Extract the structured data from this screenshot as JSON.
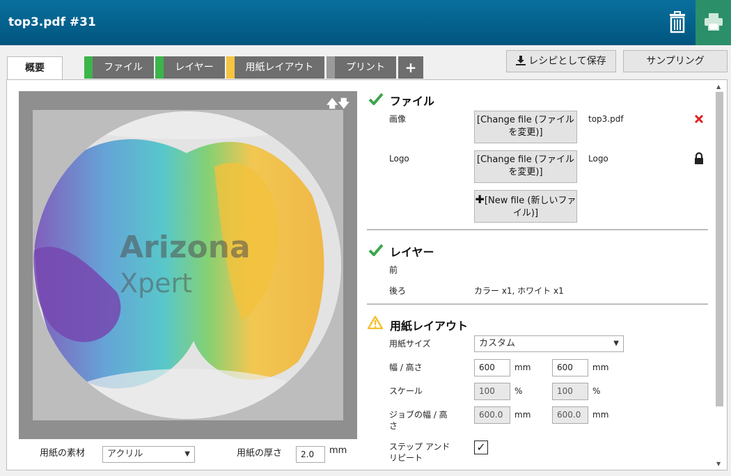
{
  "header": {
    "title": "top3.pdf #31"
  },
  "tabs": [
    {
      "label": "概要",
      "color": "#ffffff"
    },
    {
      "label": "ファイル",
      "color": "#3cb54a"
    },
    {
      "label": "レイヤー",
      "color": "#3cb54a"
    },
    {
      "label": "用紙レイアウト",
      "color": "#f5c542"
    },
    {
      "label": "プリント",
      "color": "#9a9a9a"
    },
    {
      "label": "+"
    }
  ],
  "toolbar": {
    "save_label": "レシピとして保存",
    "sampling_label": "サンプリング"
  },
  "preview": {
    "watermark_line1": "Arizona",
    "watermark_line2": "Xpert",
    "arrows": "🡅🡇"
  },
  "media": {
    "material_label": "用紙の素材",
    "material_value": "アクリル",
    "thickness_label": "用紙の厚さ",
    "thickness_value": "2.0",
    "thickness_unit": "mm"
  },
  "file_section": {
    "title": "ファイル",
    "image_label": "画像",
    "change_file_label": "[Change file (ファイルを変更)]",
    "image_filename": "top3.pdf",
    "logo_label": "Logo",
    "logo_filename": "Logo",
    "new_file_label": "[New file (新しいファイル)]"
  },
  "layer_section": {
    "title": "レイヤー",
    "front_label": "前",
    "back_label": "後ろ",
    "back_value": "カラー x1, ホワイト x1"
  },
  "layout_section": {
    "title": "用紙レイアウト",
    "size_label": "用紙サイズ",
    "size_value": "カスタム",
    "wh_label": "幅 / 高さ",
    "width": "600",
    "height": "600",
    "unit_mm": "mm",
    "scale_label": "スケール",
    "scale_x": "100",
    "scale_y": "100",
    "unit_pct": "%",
    "job_wh_label": "ジョブの幅 / 高さ",
    "job_width": "600.0",
    "job_height": "600.0",
    "step_label": "ステップ アンド リピート",
    "step_checked": "✓"
  },
  "colors": {
    "header": "#00557f",
    "print": "#2b8f6a",
    "ok": "#3aa64a",
    "warn": "#f2c12e",
    "delete": "#e02020"
  }
}
